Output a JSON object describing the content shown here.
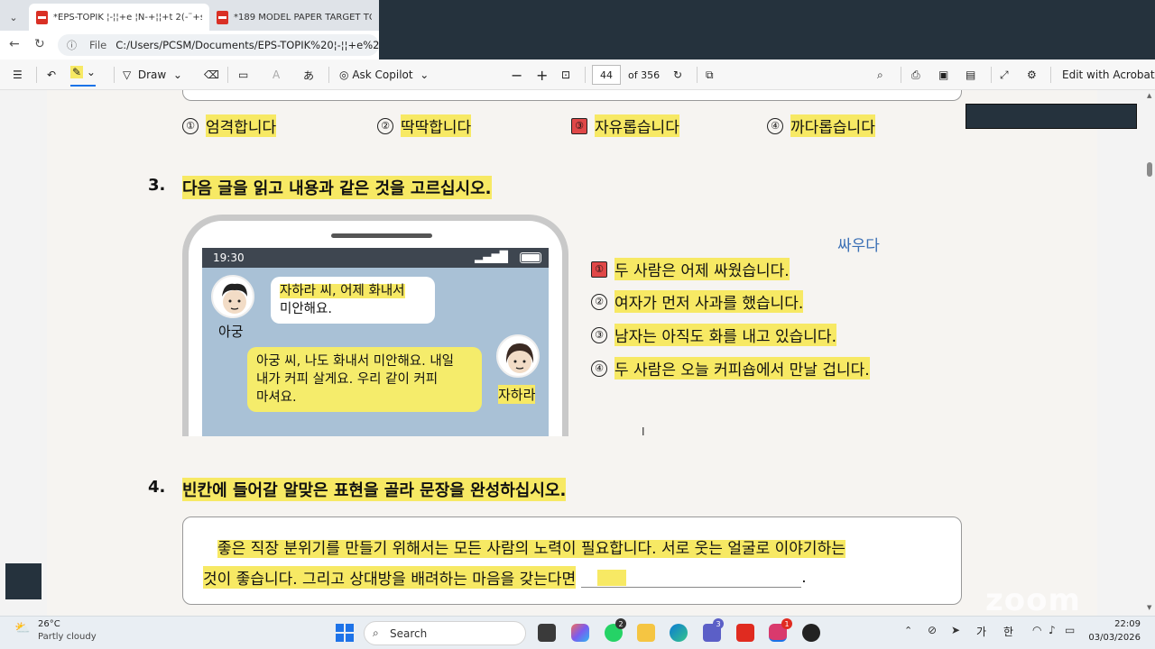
{
  "browser": {
    "tabs": [
      {
        "title": "*EPS-TOPIK ¦-¦¦+e ¦Ñ-+¦¦+t 2(-¨+s+ ×"
      },
      {
        "title": "*189 MODEL PAPER TARGET TO K ×"
      }
    ],
    "url_scheme": "File",
    "url": "C:/Users/PCSM/Documents/EPS-TOPIK%20¦-¦¦+e%20¦Ñ-+¦¦+"
  },
  "toolbar": {
    "draw": "Draw",
    "ask_copilot": "Ask Copilot",
    "page_current": "44",
    "page_total": "of 356",
    "edit_acrobat": "Edit with Acrobat"
  },
  "q2": {
    "options": [
      {
        "num": "①",
        "text": "엄격합니다"
      },
      {
        "num": "②",
        "text": "딱딱합니다"
      },
      {
        "num": "③",
        "text": "자유롭습니다",
        "selected": true
      },
      {
        "num": "④",
        "text": "까다롭습니다"
      }
    ]
  },
  "q3": {
    "number": "3.",
    "prompt": "다음 글을 읽고 내용과 같은 것을 고르십시오.",
    "annotation": "싸우다",
    "phone": {
      "time": "19:30",
      "msg1": "자하라 씨, 어제 화내서 미안해요.",
      "msg1_line1": "자하라 씨, 어제 화내서",
      "msg1_line2": "미안해요.",
      "name1": "아궁",
      "msg2_line1": "아궁 씨, 나도 화내서 미안해요. 내일",
      "msg2_line2": "내가 커피 살게요. 우리 같이 커피",
      "msg2_line3": "마셔요.",
      "name2": "자하라"
    },
    "options": [
      {
        "num": "①",
        "text": "두 사람은 어제 싸웠습니다.",
        "selected": true
      },
      {
        "num": "②",
        "text": "여자가 먼저 사과를 했습니다."
      },
      {
        "num": "③",
        "text": "남자는 아직도 화를 내고 있습니다."
      },
      {
        "num": "④",
        "text": "두 사람은 오늘 커피숍에서 만날 겁니다."
      }
    ]
  },
  "q4": {
    "number": "4.",
    "prompt": "빈칸에 들어갈 알맞은 표현을 골라 문장을 완성하십시오.",
    "line1": "좋은 직장 분위기를 만들기 위해서는 모든 사람의 노력이 필요합니다. 서로 웃는 얼굴로 이야기하는",
    "line2": "것이 좋습니다. 그리고 상대방을 배려하는 마음을 갖는다면",
    "line2_end": "."
  },
  "watermark": "zoom",
  "taskbar": {
    "weather_temp": "26°C",
    "weather_desc": "Partly cloudy",
    "search": "Search",
    "badge_whatsapp": "2",
    "badge_teams": "3",
    "badge_app": "1",
    "ime1": "가",
    "ime2": "한",
    "time": "22:09",
    "date": "03/03/2026"
  }
}
